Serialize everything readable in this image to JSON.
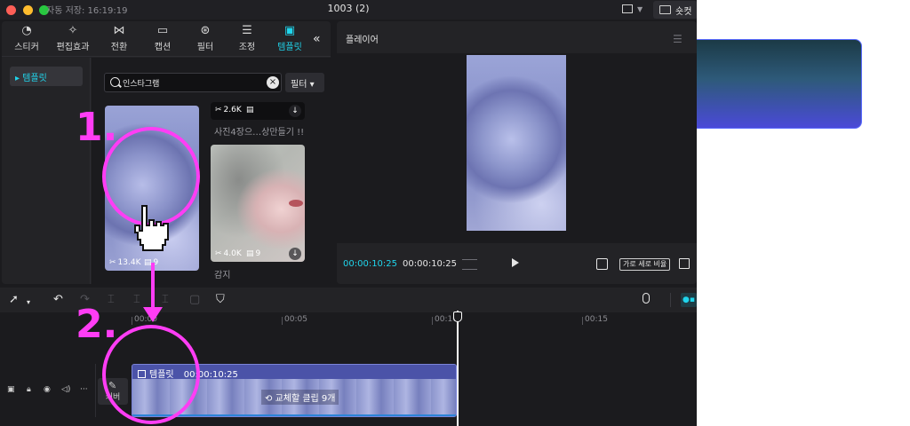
{
  "titlebar": {
    "autosave": "자동 저장: 16:19:19",
    "title": "1003 (2)",
    "shortcut_label": "숏컷"
  },
  "tabs": [
    {
      "label": "스티커",
      "icon": "sticker-icon"
    },
    {
      "label": "편집효과",
      "icon": "effects-icon"
    },
    {
      "label": "전환",
      "icon": "transition-icon"
    },
    {
      "label": "캡션",
      "icon": "caption-icon"
    },
    {
      "label": "필터",
      "icon": "filter-icon"
    },
    {
      "label": "조정",
      "icon": "adjust-icon"
    },
    {
      "label": "템플릿",
      "icon": "template-icon",
      "active": true
    }
  ],
  "sidenav": {
    "item": "▸ 템플릿"
  },
  "search": {
    "value": "인스타그램",
    "filter_label": "필터"
  },
  "cards": [
    {
      "uses": "13.4K",
      "clips": "9"
    },
    {
      "uses": "2.6K",
      "caption": "사진4장으…상만들기 !!"
    },
    {
      "uses": "4.0K",
      "clips": "9",
      "caption": "감지"
    }
  ],
  "player": {
    "title": "플레이어",
    "current_time": "00:00:10:25",
    "total_time": "00:00:10:25",
    "ratio_label": "가로 세로 비율"
  },
  "timeline": {
    "ticks": [
      "00:00",
      "00:05",
      "00:10",
      "00:15"
    ],
    "clip_title": "템플릿",
    "clip_duration": "00:00:10:25",
    "clip_replace": "교체할 클립 9개",
    "cover_label": "커버"
  },
  "annotations": {
    "step1": "1.",
    "step2": "2."
  },
  "colors": {
    "accent": "#20d5ec",
    "annotation": "#ff3df5",
    "clip": "#5860b8"
  }
}
